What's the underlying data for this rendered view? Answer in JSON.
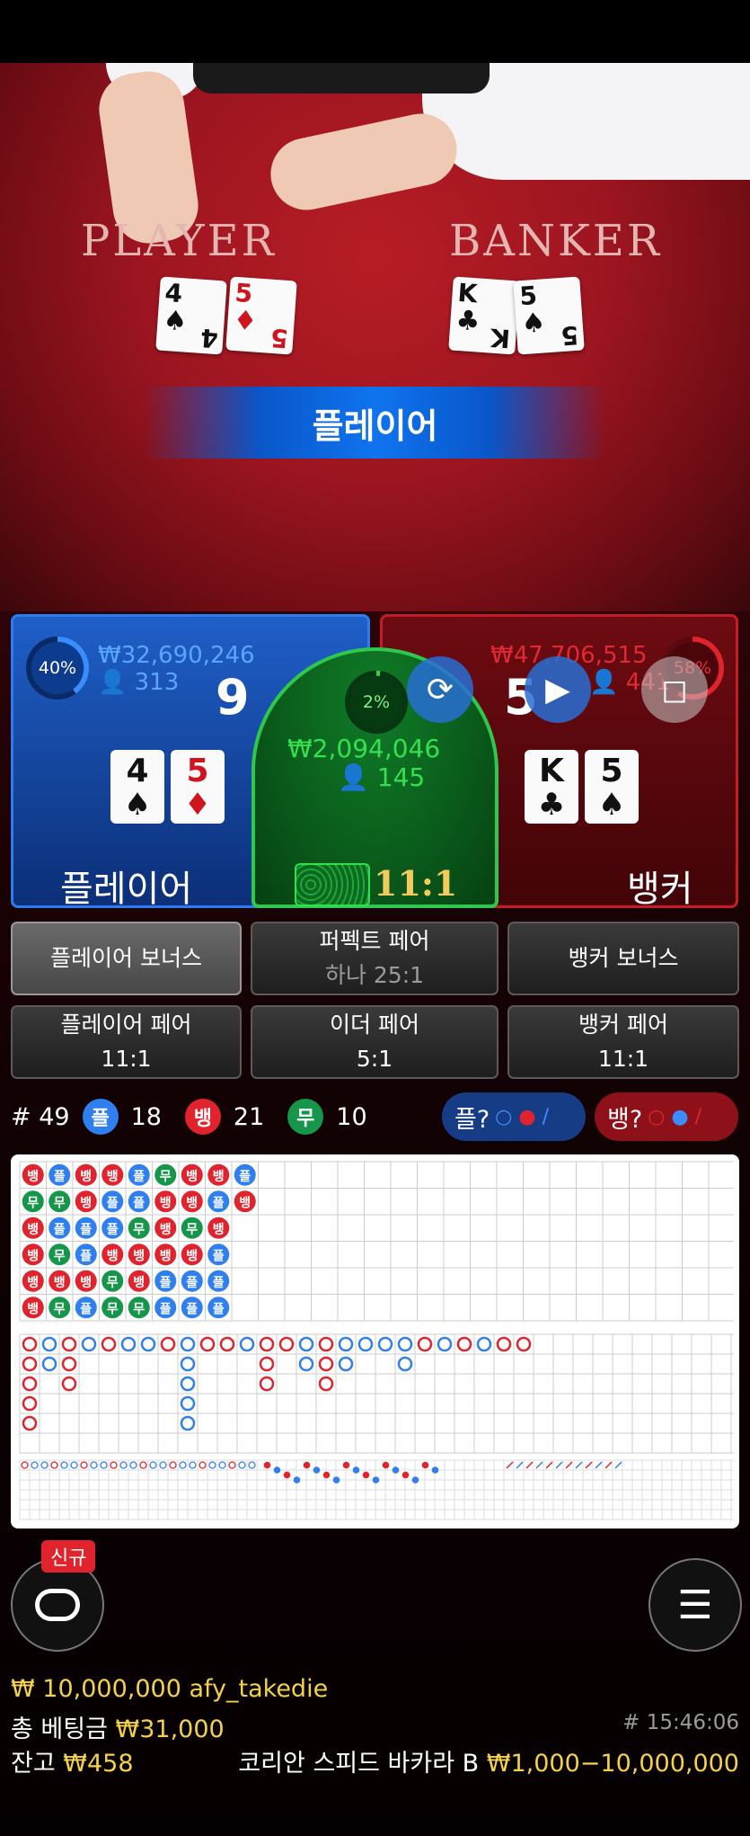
{
  "table": {
    "player_title": "PLAYER",
    "banker_title": "BANKER",
    "player_cards": [
      {
        "rank": "4",
        "suit": "♠",
        "color": "black"
      },
      {
        "rank": "5",
        "suit": "♦",
        "color": "red"
      }
    ],
    "banker_cards": [
      {
        "rank": "K",
        "suit": "♣",
        "color": "black"
      },
      {
        "rank": "5",
        "suit": "♠",
        "color": "black"
      }
    ],
    "result_banner": "플레이어"
  },
  "player": {
    "percent": "40%",
    "percent_value": 40,
    "amount": "₩32,690,246",
    "users": "313",
    "score": "9",
    "cards": [
      {
        "rank": "4",
        "suit": "♠"
      },
      {
        "rank": "5",
        "suit": "♦"
      }
    ],
    "label": "플레이어",
    "color": "#1f5fc8"
  },
  "tie": {
    "percent": "2%",
    "percent_value": 2,
    "amount": "₩2,094,046",
    "users": "145",
    "odds": "11:1",
    "color": "#0f7c27"
  },
  "banker": {
    "percent": "58%",
    "percent_value": 58,
    "amount": "₩47,706,515",
    "users": "441",
    "score": "5",
    "cards": [
      {
        "rank": "K",
        "suit": "♣"
      },
      {
        "rank": "5",
        "suit": "♠"
      }
    ],
    "label": "뱅커",
    "color": "#c51c25"
  },
  "controls": {
    "icons": [
      "rotate-camera-icon",
      "replay-icon",
      "stop-icon"
    ]
  },
  "side_bets": {
    "player_bonus": "플레이어 보너스",
    "perfect_pair": "퍼펙트 페어",
    "perfect_pair_odds": "하나 25:1",
    "banker_bonus": "뱅커 보너스",
    "player_pair": "플레이어 페어",
    "player_pair_odds": "11:1",
    "either_pair": "이더 페어",
    "either_pair_odds": "5:1",
    "banker_pair": "뱅커 페어",
    "banker_pair_odds": "11:1"
  },
  "stats": {
    "round_label": "# 49",
    "player_symbol": "플",
    "player_count": "18",
    "banker_symbol": "뱅",
    "banker_count": "21",
    "tie_symbol": "무",
    "tie_count": "10",
    "ask_player": "플?",
    "ask_banker": "뱅?"
  },
  "roadmap": {
    "bead_plate": [
      [
        "뱅",
        "무",
        "뱅",
        "뱅",
        "뱅",
        "뱅"
      ],
      [
        "플",
        "무",
        "플",
        "무",
        "뱅",
        "무"
      ],
      [
        "뱅",
        "뱅",
        "플",
        "플",
        "뱅",
        "플"
      ],
      [
        "뱅",
        "플",
        "플",
        "뱅",
        "무",
        "무"
      ],
      [
        "플",
        "플",
        "무",
        "뱅",
        "뱅",
        "무"
      ],
      [
        "무",
        "뱅",
        "뱅",
        "뱅",
        "플",
        "플"
      ],
      [
        "뱅",
        "뱅",
        "무",
        "뱅",
        "플",
        "플"
      ],
      [
        "뱅",
        "플",
        "뱅",
        "플",
        "플",
        "플"
      ],
      [
        "플",
        "뱅",
        "",
        "",
        "",
        ""
      ]
    ]
  },
  "footer": {
    "new_badge": "신규",
    "bet_limit_user": "₩ 10,000,000 afy_takedie",
    "total_bet_label": "총 베팅금",
    "total_bet_value": "₩31,000",
    "balance_label": "잔고",
    "balance_value": "₩458",
    "table_name": "코리안 스피드 바카라 B",
    "table_limit": "₩1,000−10,000,000",
    "game_time": "# 15:46:06"
  }
}
